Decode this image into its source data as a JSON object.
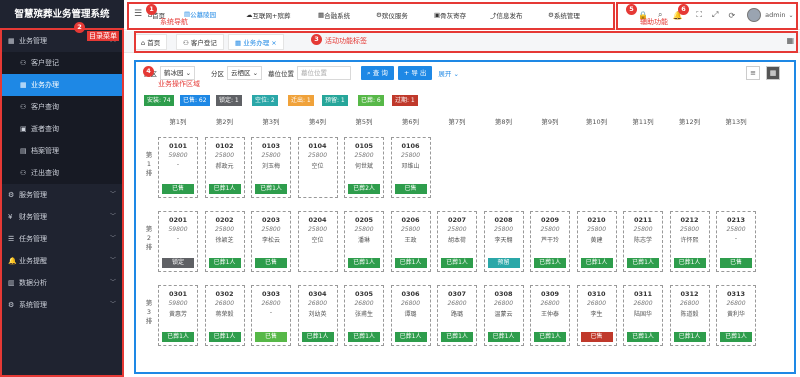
{
  "app": {
    "title": "智慧殡葬业务管理系统"
  },
  "sidebar": {
    "items": [
      {
        "label": "业务管理",
        "icon": "grid-icon",
        "level": "group",
        "open": true
      },
      {
        "label": "客户登记",
        "icon": "user-icon",
        "level": "sub"
      },
      {
        "label": "业务办理",
        "icon": "apps-icon",
        "level": "sub",
        "active": true
      },
      {
        "label": "客户查询",
        "icon": "user-icon",
        "level": "sub"
      },
      {
        "label": "逝者查询",
        "icon": "id-card-icon",
        "level": "sub"
      },
      {
        "label": "档案管理",
        "icon": "archive-icon",
        "level": "sub"
      },
      {
        "label": "迁出查询",
        "icon": "user-icon",
        "level": "sub"
      },
      {
        "label": "服务管理",
        "icon": "service-icon",
        "level": "group"
      },
      {
        "label": "财务管理",
        "icon": "finance-icon",
        "level": "group"
      },
      {
        "label": "任务管理",
        "icon": "task-icon",
        "level": "group"
      },
      {
        "label": "业务提醒",
        "icon": "bell-icon",
        "level": "group"
      },
      {
        "label": "数据分析",
        "icon": "chart-icon",
        "level": "group"
      },
      {
        "label": "系统管理",
        "icon": "gear-icon",
        "level": "group"
      }
    ]
  },
  "topnav": {
    "items": [
      {
        "label": "首页",
        "icon": "home-icon"
      },
      {
        "label": "公墓陵园",
        "icon": "cemetery-icon",
        "active": true
      },
      {
        "label": "互联网+殡葬",
        "icon": "cloud-icon"
      },
      {
        "label": "合融系统",
        "icon": "apps-icon"
      },
      {
        "label": "殡仪服务",
        "icon": "service-icon"
      },
      {
        "label": "骨灰寄存",
        "icon": "box-icon"
      },
      {
        "label": "信息发布",
        "icon": "share-icon"
      },
      {
        "label": "系统管理",
        "icon": "gear-icon"
      }
    ],
    "user": "admin"
  },
  "tabs": [
    {
      "label": "首页"
    },
    {
      "label": "客户登记"
    },
    {
      "label": "业务办理",
      "active": true
    }
  ],
  "annotations": {
    "m1": "1",
    "c1": "系统导航",
    "m2": "2",
    "c2": "目录菜单",
    "m3": "3",
    "c3": "活动功能标签",
    "m4": "4",
    "c4": "业务操作区域",
    "m5": "5",
    "c5": "辅助功能",
    "m6": "6"
  },
  "filter": {
    "yuanqu_label": "园区",
    "yuanqu_value": "鹤冰园",
    "fenqu_label": "分区",
    "fenqu_value": "云栖区",
    "muwei_label": "墓位位置",
    "muwei_placeholder": "墓位位置",
    "query_label": "查 询",
    "export_label": "+ 导 出",
    "expand_label": "展开"
  },
  "stats": [
    {
      "label": "安装: 74",
      "color": "#2e9d4c"
    },
    {
      "label": "已售: 62",
      "color": "#1e88e5"
    },
    {
      "label": "锁定: 1",
      "color": "#5f6165"
    },
    {
      "label": "空位: 2",
      "color": "#2aa7a8"
    },
    {
      "label": "迁出: 1",
      "color": "#f0a23a"
    },
    {
      "label": "预留: 1",
      "color": "#26a69a"
    },
    {
      "label": "已葬: 6",
      "color": "#57b848"
    },
    {
      "label": "过期: 1",
      "color": "#c0392b"
    }
  ],
  "columns": [
    "第1列",
    "第2列",
    "第3列",
    "第4列",
    "第5列",
    "第6列",
    "第7列",
    "第8列",
    "第9列",
    "第10列",
    "第11列",
    "第12列",
    "第13列"
  ],
  "rows": [
    {
      "label": "第1排",
      "cells": [
        {
          "no": "0101",
          "area": "59800",
          "owner": "-",
          "status": "已售",
          "color": "g"
        },
        {
          "no": "0102",
          "area": "25800",
          "owner": "郝政元",
          "status": "已葬1人",
          "color": "g"
        },
        {
          "no": "0103",
          "area": "25800",
          "owner": "刘玉梅",
          "status": "已葬1人",
          "color": "g"
        },
        {
          "no": "0104",
          "area": "25800",
          "owner": "空位",
          "status": "",
          "color": ""
        },
        {
          "no": "0105",
          "area": "25800",
          "owner": "何世斌",
          "status": "已葬2人",
          "color": "g"
        },
        {
          "no": "0106",
          "area": "25800",
          "owner": "邓维山",
          "status": "已售",
          "color": "g"
        }
      ]
    },
    {
      "label": "第2排",
      "cells": [
        {
          "no": "0201",
          "area": "59800",
          "owner": "-",
          "status": "锁定",
          "color": "dk"
        },
        {
          "no": "0202",
          "area": "25800",
          "owner": "徐颖芝",
          "status": "已葬1人",
          "color": "g"
        },
        {
          "no": "0203",
          "area": "25800",
          "owner": "李松云",
          "status": "已售",
          "color": "g"
        },
        {
          "no": "0204",
          "area": "25800",
          "owner": "空位",
          "status": "",
          "color": ""
        },
        {
          "no": "0205",
          "area": "25800",
          "owner": "潘琳",
          "status": "已葬1人",
          "color": "g"
        },
        {
          "no": "0206",
          "area": "25800",
          "owner": "王政",
          "status": "已葬1人",
          "color": "g"
        },
        {
          "no": "0207",
          "area": "25800",
          "owner": "胡本荷",
          "status": "已葬1人",
          "color": "g"
        },
        {
          "no": "0208",
          "area": "25800",
          "owner": "李天翱",
          "status": "预留",
          "color": "tl"
        },
        {
          "no": "0209",
          "area": "25800",
          "owner": "芦干玲",
          "status": "已葬1人",
          "color": "g"
        },
        {
          "no": "0210",
          "area": "25800",
          "owner": "黄建",
          "status": "已葬1人",
          "color": "g"
        },
        {
          "no": "0211",
          "area": "25800",
          "owner": "陈志学",
          "status": "已葬1人",
          "color": "g"
        },
        {
          "no": "0212",
          "area": "25800",
          "owner": "许怀熙",
          "status": "已葬1人",
          "color": "g"
        },
        {
          "no": "0213",
          "area": "25800",
          "owner": "-",
          "status": "已售",
          "color": "g"
        }
      ]
    },
    {
      "label": "第3排",
      "cells": [
        {
          "no": "0301",
          "area": "59800",
          "owner": "黄惠芳",
          "status": "已葬1人",
          "color": "g"
        },
        {
          "no": "0302",
          "area": "26800",
          "owner": "蒋荣毅",
          "status": "已葬1人",
          "color": "g"
        },
        {
          "no": "0303",
          "area": "26800",
          "owner": "-",
          "status": "已售",
          "color": "gl"
        },
        {
          "no": "0304",
          "area": "26800",
          "owner": "刘幼英",
          "status": "已葬1人",
          "color": "g"
        },
        {
          "no": "0305",
          "area": "26800",
          "owner": "张甫生",
          "status": "已葬1人",
          "color": "g"
        },
        {
          "no": "0306",
          "area": "26800",
          "owner": "谭璐",
          "status": "已葬1人",
          "color": "g"
        },
        {
          "no": "0307",
          "area": "26800",
          "owner": "路璐",
          "status": "已葬1人",
          "color": "g"
        },
        {
          "no": "0308",
          "area": "26800",
          "owner": "温蒙云",
          "status": "已葬1人",
          "color": "g"
        },
        {
          "no": "0309",
          "area": "26800",
          "owner": "王仲泰",
          "status": "已葬1人",
          "color": "g"
        },
        {
          "no": "0310",
          "area": "26800",
          "owner": "李生",
          "status": "已售",
          "color": "rd"
        },
        {
          "no": "0311",
          "area": "26800",
          "owner": "陆国华",
          "status": "已葬1人",
          "color": "g"
        },
        {
          "no": "0312",
          "area": "26800",
          "owner": "陈道毅",
          "status": "已葬1人",
          "color": "g"
        },
        {
          "no": "0313",
          "area": "26800",
          "owner": "黄利华",
          "status": "已葬1人",
          "color": "g"
        }
      ]
    }
  ]
}
